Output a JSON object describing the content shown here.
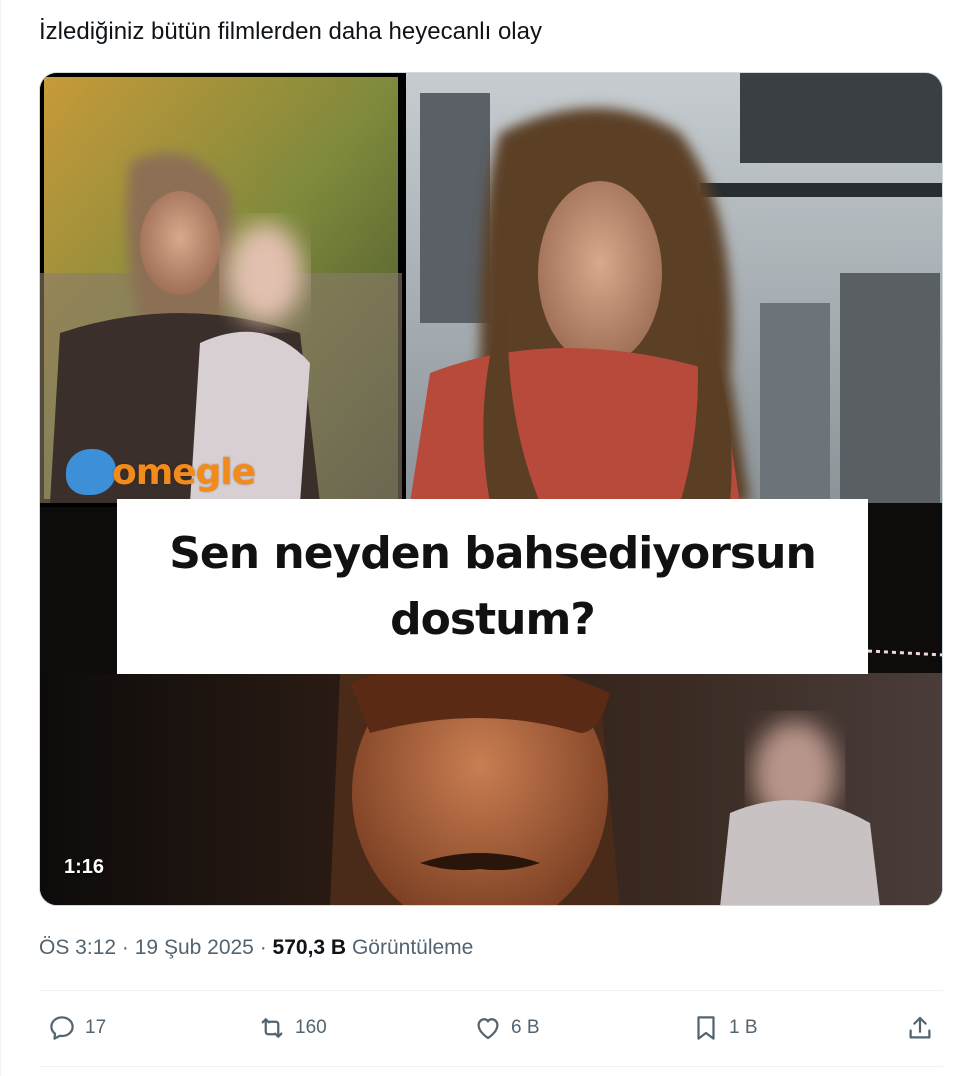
{
  "tweet": {
    "text": "İzlediğiniz bütün filmlerden daha heyecanlı olay"
  },
  "media": {
    "watermark": "omegle",
    "caption": "Sen neyden bahsediyorsun dostum?",
    "duration": "1:16"
  },
  "meta": {
    "time": "ÖS 3:12",
    "separator": "·",
    "date": "19 Şub 2025",
    "views_count": "570,3 B",
    "views_label": "Görüntüleme"
  },
  "actions": {
    "replies": "17",
    "reposts": "160",
    "likes": "6 B",
    "bookmarks": "1 B"
  },
  "icons": {
    "reply": "speech-bubble-icon",
    "repost": "repost-arrows-icon",
    "like": "heart-icon",
    "bookmark": "bookmark-icon",
    "share": "share-upload-icon"
  },
  "colors": {
    "text": "#0f1419",
    "secondary": "#536471",
    "border": "#eff3f4"
  }
}
